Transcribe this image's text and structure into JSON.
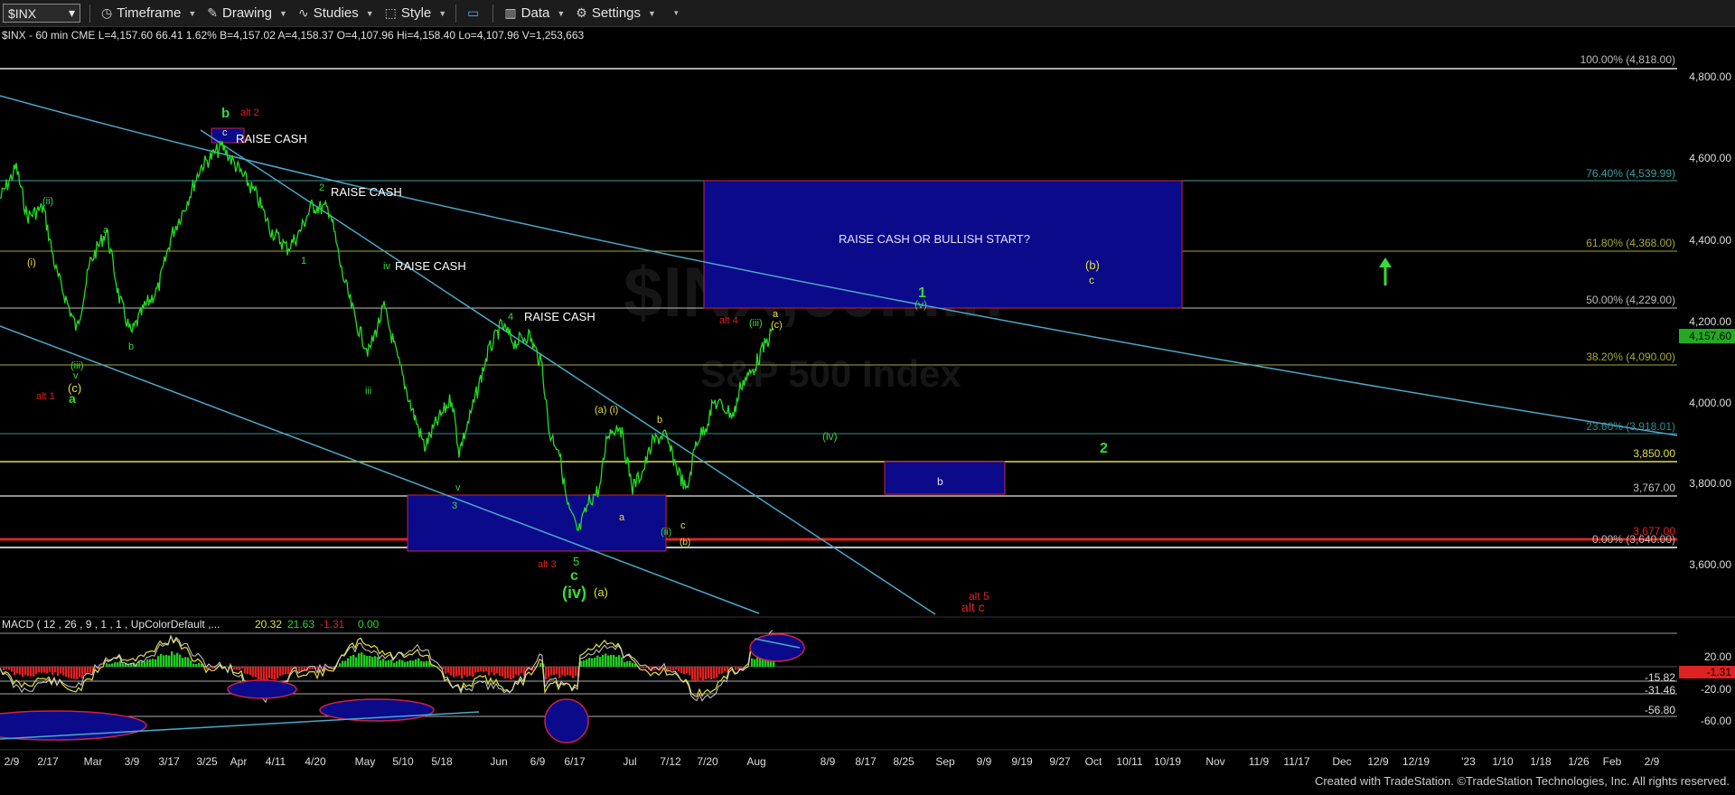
{
  "toolbar": {
    "symbol": "$INX",
    "timeframe": "Timeframe",
    "drawing": "Drawing",
    "studies": "Studies",
    "style": "Style",
    "data": "Data",
    "settings": "Settings"
  },
  "header": {
    "info": "$INX - 60 min  CME  L=4,157.60  66.41  1.62%  B=4,157.02  A=4,158.37  O=4,107.96  Hi=4,158.40  Lo=4,107.96  V=1,253,663"
  },
  "watermark": {
    "symbol": "$INX,60min",
    "name": "S&P 500 Index"
  },
  "macd": {
    "label": "MACD ( 12 , 26 , 9 , 1 , 1 , UpColorDefault ,...",
    "v1": "20.32",
    "v2": "21.63",
    "v3": "-1.31",
    "v4": "0.00"
  },
  "price_axis": [
    "4,800.00",
    "4,600.00",
    "4,400.00",
    "4,200.00",
    "4,000.00",
    "3,800.00",
    "3,600.00"
  ],
  "last_price": "4,157.60",
  "macd_axis": [
    "20.00",
    "-20.00",
    "-60.00"
  ],
  "macd_levels": [
    "-15.82",
    "-31.46",
    "-56.80"
  ],
  "macd_last": "-1.31",
  "fib": [
    "100.00% (4,818.00)",
    "76.40% (4,539.99)",
    "61.80% (4,368.00)",
    "50.00% (4,229.00)",
    "38.20% (4,090.00)",
    "23.60% (3,918.01)",
    "0.00% (3,640.00)"
  ],
  "levels": [
    "3,850.00",
    "3,767.00",
    "3,677.00"
  ],
  "date_axis": [
    "2/9",
    "2/17",
    "Mar",
    "3/9",
    "3/17",
    "3/25",
    "Apr",
    "4/11",
    "4/20",
    "May",
    "5/10",
    "5/18",
    "Jun",
    "6/9",
    "6/17",
    "Jul",
    "7/12",
    "7/20",
    "Aug",
    "8/9",
    "8/17",
    "8/25",
    "Sep",
    "9/9",
    "9/19",
    "9/27",
    "Oct",
    "10/11",
    "10/19",
    "Nov",
    "11/9",
    "11/17",
    "Dec",
    "12/9",
    "12/19",
    "'23",
    "1/10",
    "1/18",
    "1/26",
    "Feb",
    "2/9"
  ],
  "notes": {
    "raise1": "RAISE CASH",
    "raise2": "RAISE CASH",
    "raise3": "RAISE CASH",
    "raise4": "RAISE CASH",
    "box": "RAISE CASH OR BULLISH START?"
  },
  "waves": {
    "b_green": "b",
    "alt2": "alt 2",
    "c_small": "c",
    "two_small": "2",
    "one_small": "1",
    "a_left1": "a",
    "b_left": "b",
    "i_left": "(i)",
    "ii_left": "(ii)",
    "iii_left": "(iii)",
    "v_left": "v",
    "c_left": "(c)",
    "a_left2": "a",
    "alt1": "alt 1",
    "iv_small": "iv",
    "iii_small": "iii",
    "v_small": "v",
    "three_small": "3",
    "four_small": "4",
    "alt3": "alt 3",
    "five": "5",
    "c_big": "c",
    "iv_big": "(iv)",
    "a_paren": "(a)",
    "a_i": "(a) (i)",
    "b_mid": "b",
    "a_mid": "a",
    "c_mid": "c",
    "ii_mid": "(ii)",
    "b_paren": "(b)",
    "alt4": "alt 4",
    "iii_top": "(iii)",
    "a_top": "a",
    "c_top": "(c)",
    "one_big": "1",
    "v_paren": "(v)",
    "iv_paren": "(iv)",
    "b_yellow": "(b)",
    "c_box": "c",
    "two_big": "2",
    "b_box": "b",
    "alt5": "alt 5",
    "altc": "alt c"
  },
  "credit": "Created with TradeStation. ©TradeStation Technologies, Inc. All rights reserved.",
  "colors": {
    "bull": "#33dd33",
    "bear": "#dd2222",
    "box": "#0a0a8a",
    "trend": "#4aa8c8",
    "fib": "#a8a838"
  }
}
